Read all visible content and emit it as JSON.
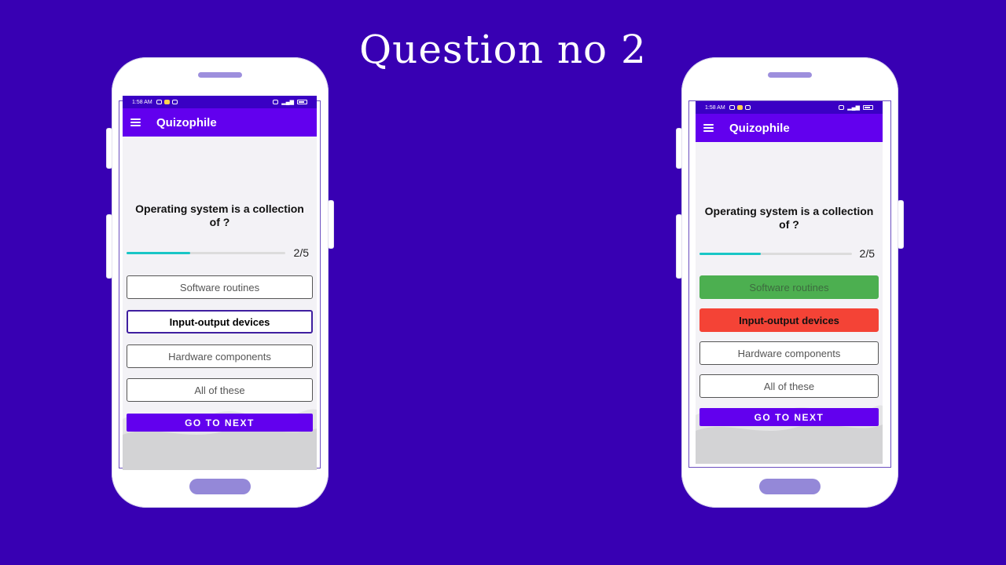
{
  "slide": {
    "title": "Question no 2"
  },
  "phones": [
    {
      "status": {
        "time": "1:58 AM"
      },
      "app": {
        "title": "Quizophile"
      },
      "question": "Operating system is a collection of ?",
      "progress": {
        "current": 2,
        "total": 5,
        "label": "2/5",
        "fraction": 0.4
      },
      "options": [
        {
          "label": "Software routines",
          "state": "default"
        },
        {
          "label": "Input-output devices",
          "state": "selected"
        },
        {
          "label": "Hardware components",
          "state": "default"
        },
        {
          "label": "All of these",
          "state": "default"
        }
      ],
      "next_label": "GO TO NEXT"
    },
    {
      "status": {
        "time": "1:58 AM"
      },
      "app": {
        "title": "Quizophile"
      },
      "question": "Operating system is a collection of ?",
      "progress": {
        "current": 2,
        "total": 5,
        "label": "2/5",
        "fraction": 0.4
      },
      "options": [
        {
          "label": "Software routines",
          "state": "correct"
        },
        {
          "label": "Input-output devices",
          "state": "wrong"
        },
        {
          "label": "Hardware components",
          "state": "default"
        },
        {
          "label": "All of these",
          "state": "default"
        }
      ],
      "next_label": "GO TO NEXT"
    }
  ],
  "colors": {
    "background": "#3800b3",
    "app_bar": "#6200ee",
    "status_bar": "#3a00c4",
    "progress_fill": "#19c6c6",
    "correct": "#4caf50",
    "wrong": "#f44336"
  }
}
